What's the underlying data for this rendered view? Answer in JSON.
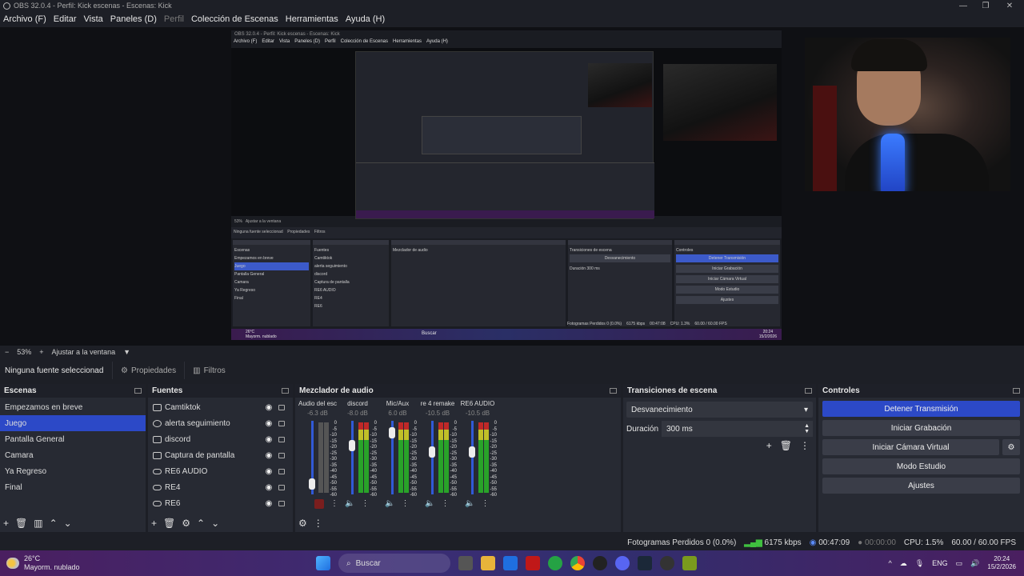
{
  "window": {
    "title": "OBS 32.0.4 - Perfil: Kick escenas - Escenas: Kick",
    "controls": [
      "—",
      "❐",
      "✕"
    ]
  },
  "menu": [
    "Archivo (F)",
    "Editar",
    "Vista",
    "Paneles (D)",
    "Perfil",
    "Colección de Escenas",
    "Herramientas",
    "Ayuda (H)"
  ],
  "zoom": {
    "minus": "−",
    "value": "53%",
    "plus": "+",
    "fit_label": "Ajustar a la ventana"
  },
  "source_bar": {
    "selected_source": "Ninguna fuente seleccionad",
    "properties": "Propiedades",
    "filters": "Filtros"
  },
  "scenes": {
    "title": "Escenas",
    "items": [
      "Empezamos en breve",
      "Juego",
      "Pantalla General",
      "Camara",
      "Ya Regreso",
      "Final"
    ],
    "selected_index": 1
  },
  "sources": {
    "title": "Fuentes",
    "items": [
      {
        "label": "Camtiktok",
        "icon": "monitor-icon"
      },
      {
        "label": "alerta seguimiento",
        "icon": "globe-icon"
      },
      {
        "label": "discord",
        "icon": "monitor-icon"
      },
      {
        "label": "Captura de pantalla",
        "icon": "monitor-icon"
      },
      {
        "label": "RE6 AUDIO",
        "icon": "gamepad-icon"
      },
      {
        "label": "RE4",
        "icon": "gamepad-icon"
      },
      {
        "label": "RE6",
        "icon": "gamepad-icon"
      }
    ]
  },
  "mixer": {
    "title": "Mezclador de audio",
    "channels": [
      {
        "name": "Audio del escritorio",
        "db": "-6.3 dB",
        "level": 0.1
      },
      {
        "name": "discord",
        "db": "-8.0 dB",
        "level": 0.7
      },
      {
        "name": "Mic/Aux",
        "db": "6.0 dB",
        "level": 0.9
      },
      {
        "name": "re 4 remake",
        "db": "-10.5 dB",
        "level": 0.6
      },
      {
        "name": "RE6 AUDIO",
        "db": "-10.5 dB",
        "level": 0.6
      }
    ],
    "scale": [
      "0",
      "-5",
      "-10",
      "-15",
      "-20",
      "-25",
      "-30",
      "-35",
      "-40",
      "-45",
      "-50",
      "-55",
      "-60"
    ]
  },
  "transitions": {
    "title": "Transiciones de escena",
    "selected": "Desvanecimiento",
    "duration_label": "Duración",
    "duration_value": "300 ms"
  },
  "controls": {
    "title": "Controles",
    "stop_stream": "Detener Transmisión",
    "start_recording": "Iniciar Grabación",
    "start_virtual_cam": "Iniciar Cámara Virtual",
    "studio_mode": "Modo Estudio",
    "settings": "Ajustes"
  },
  "status": {
    "dropped_frames": "Fotogramas Perdidos 0 (0.0%)",
    "bitrate": "6175 kbps",
    "stream_time": "00:47:09",
    "record_time": "00:00:00",
    "cpu": "CPU: 1.5%",
    "fps": "60.00 / 60.00 FPS"
  },
  "taskbar": {
    "weather_temp": "26°C",
    "weather_desc": "Mayorm. nublado",
    "search": "Buscar",
    "lang": "ENG",
    "time": "20:24",
    "date": "15/2/2026"
  },
  "nested": {
    "title": "OBS 32.0.4 - Perfil: Kick escenas - Escenas: Kick",
    "menu": [
      "Archivo (F)",
      "Editar",
      "Vista",
      "Paneles (D)",
      "Perfil",
      "Colección de Escenas",
      "Herramientas",
      "Ayuda (H)"
    ],
    "source_bar": "Ninguna fuente seleccionad",
    "properties": "Propiedades",
    "filters": "Filtros",
    "scenes_title": "Escenas",
    "sources_title": "Fuentes",
    "mixer_title": "Mezclador de audio",
    "transitions_title": "Transiciones de escena",
    "controls_title": "Controles",
    "zoom": "53%",
    "fit": "Ajustar a la ventana",
    "status": "Fotogramas Perdidos 0 (0.0%)",
    "bitrate": "6175 kbps",
    "stream_time": "00:47:08",
    "cpu": "CPU: 1.3%",
    "fps": "60.00 / 60.00 FPS",
    "time": "20:24",
    "date": "15/2/2026",
    "weather_temp": "26°C",
    "weather_desc": "Mayorm. nublado",
    "search": "Buscar"
  },
  "colors": {
    "accent": "#2c49c7",
    "panel": "#272a33",
    "background": "#1d1f26",
    "meter_green": "#29a329",
    "meter_red": "#c02828"
  }
}
